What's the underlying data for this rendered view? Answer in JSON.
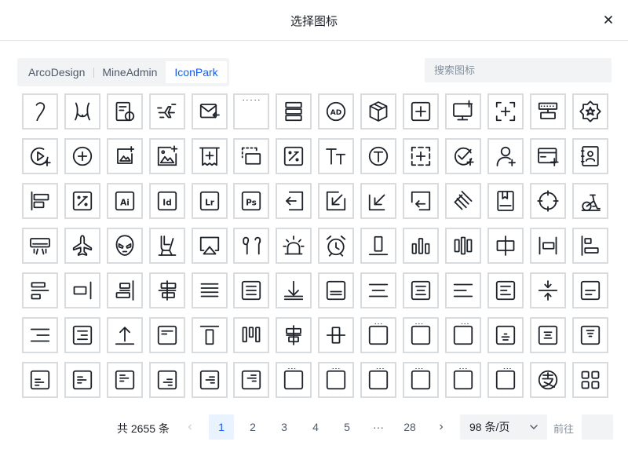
{
  "dialog": {
    "title": "选择图标",
    "close_icon": "close-icon"
  },
  "tabs": [
    {
      "label": "ArcoDesign",
      "active": false
    },
    {
      "label": "MineAdmin",
      "active": false
    },
    {
      "label": "IconPark",
      "active": true
    }
  ],
  "search": {
    "placeholder": "搜索图标",
    "value": ""
  },
  "icons": [
    "hook",
    "abdominal",
    "info-doc",
    "airplane-window",
    "mail-receive",
    "voice-wave",
    "align-rows",
    "ad-circle",
    "cube",
    "plus-square",
    "monitor-add",
    "plus-focus",
    "keyboard-slot",
    "badge-star",
    "play-add",
    "plus-circle",
    "image-add-small",
    "image-add",
    "ticket-add",
    "screen-select",
    "percent-square",
    "text-tt",
    "t-circle",
    "plus-dashed",
    "check-add",
    "user-add",
    "card-add",
    "contact-card",
    "align-left-blocks",
    "percent-square",
    "ai-file",
    "id-file",
    "lr-file",
    "ps-file",
    "enter-left",
    "arrow-down-left",
    "arrow-down-left-alt",
    "return-box",
    "slash-stack",
    "bookmark-book",
    "aim",
    "exercise-bike",
    "air-conditioner",
    "airplane",
    "alien-face",
    "airline-seat",
    "airplay",
    "airpods",
    "alarm-light",
    "alarm-clock",
    "align-bottom",
    "align-bottom-bars",
    "align-center-vertical",
    "align-center",
    "align-left-bar",
    "align-left-bars",
    "align-left-short",
    "align-right-box",
    "align-right-bars",
    "align-right-center",
    "align-justify",
    "align-text-box",
    "align-bottom-arrow",
    "align-bottom-box",
    "align-center-text",
    "align-text-center-box",
    "align-text-left",
    "align-text-left-box",
    "compress-vertical",
    "align-text-bottom-box",
    "align-text-right",
    "align-text-right-box",
    "align-top-arrow",
    "align-top-box",
    "align-top-bar",
    "align-top-bars",
    "align-center-h",
    "align-middle",
    "chart-bottom",
    "chart-bottom-left",
    "chart-bottom-right",
    "align-center-bottom",
    "align-center-middle",
    "align-center-top",
    "align-lines-bl",
    "align-lines-ml",
    "align-lines-tl",
    "align-lines-br",
    "align-lines-mr",
    "align-lines-tr",
    "bars-tl",
    "bars-tc",
    "bars-tr",
    "bars-ml",
    "bars-mc",
    "bars-mr",
    "alipay",
    "apps"
  ],
  "pagination": {
    "total_text": "共 2655 条",
    "pages": [
      "1",
      "2",
      "3",
      "4",
      "5",
      "···",
      "28"
    ],
    "current": "1",
    "page_size": "98 条/页",
    "goto_label": "前往",
    "goto_value": ""
  }
}
